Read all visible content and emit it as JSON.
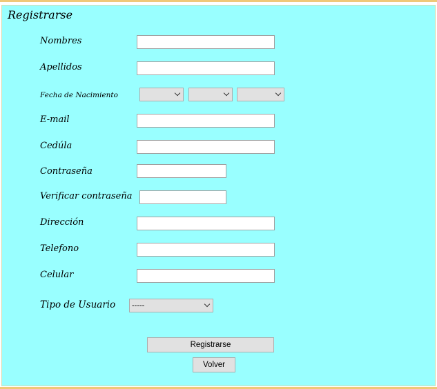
{
  "form": {
    "legend": "Registrarse",
    "fields": {
      "nombres": {
        "label": "Nombres",
        "value": ""
      },
      "apellidos": {
        "label": "Apellidos",
        "value": ""
      },
      "fecha": {
        "label": "Fecha de Nacimiento",
        "day": "",
        "month": "",
        "year": ""
      },
      "email": {
        "label": "E-mail",
        "value": ""
      },
      "cedula": {
        "label": "Cedúla",
        "value": ""
      },
      "password": {
        "label": "Contraseña",
        "value": ""
      },
      "password_confirm": {
        "label": "Verificar contraseña",
        "value": ""
      },
      "direccion": {
        "label": "Dirección",
        "value": ""
      },
      "telefono": {
        "label": "Telefono",
        "value": ""
      },
      "celular": {
        "label": "Celular",
        "value": ""
      },
      "tipo_usuario": {
        "label": "Tipo de Usuario",
        "selected": "-----"
      }
    },
    "buttons": {
      "submit": "Registrarse",
      "back": "Volver"
    }
  }
}
